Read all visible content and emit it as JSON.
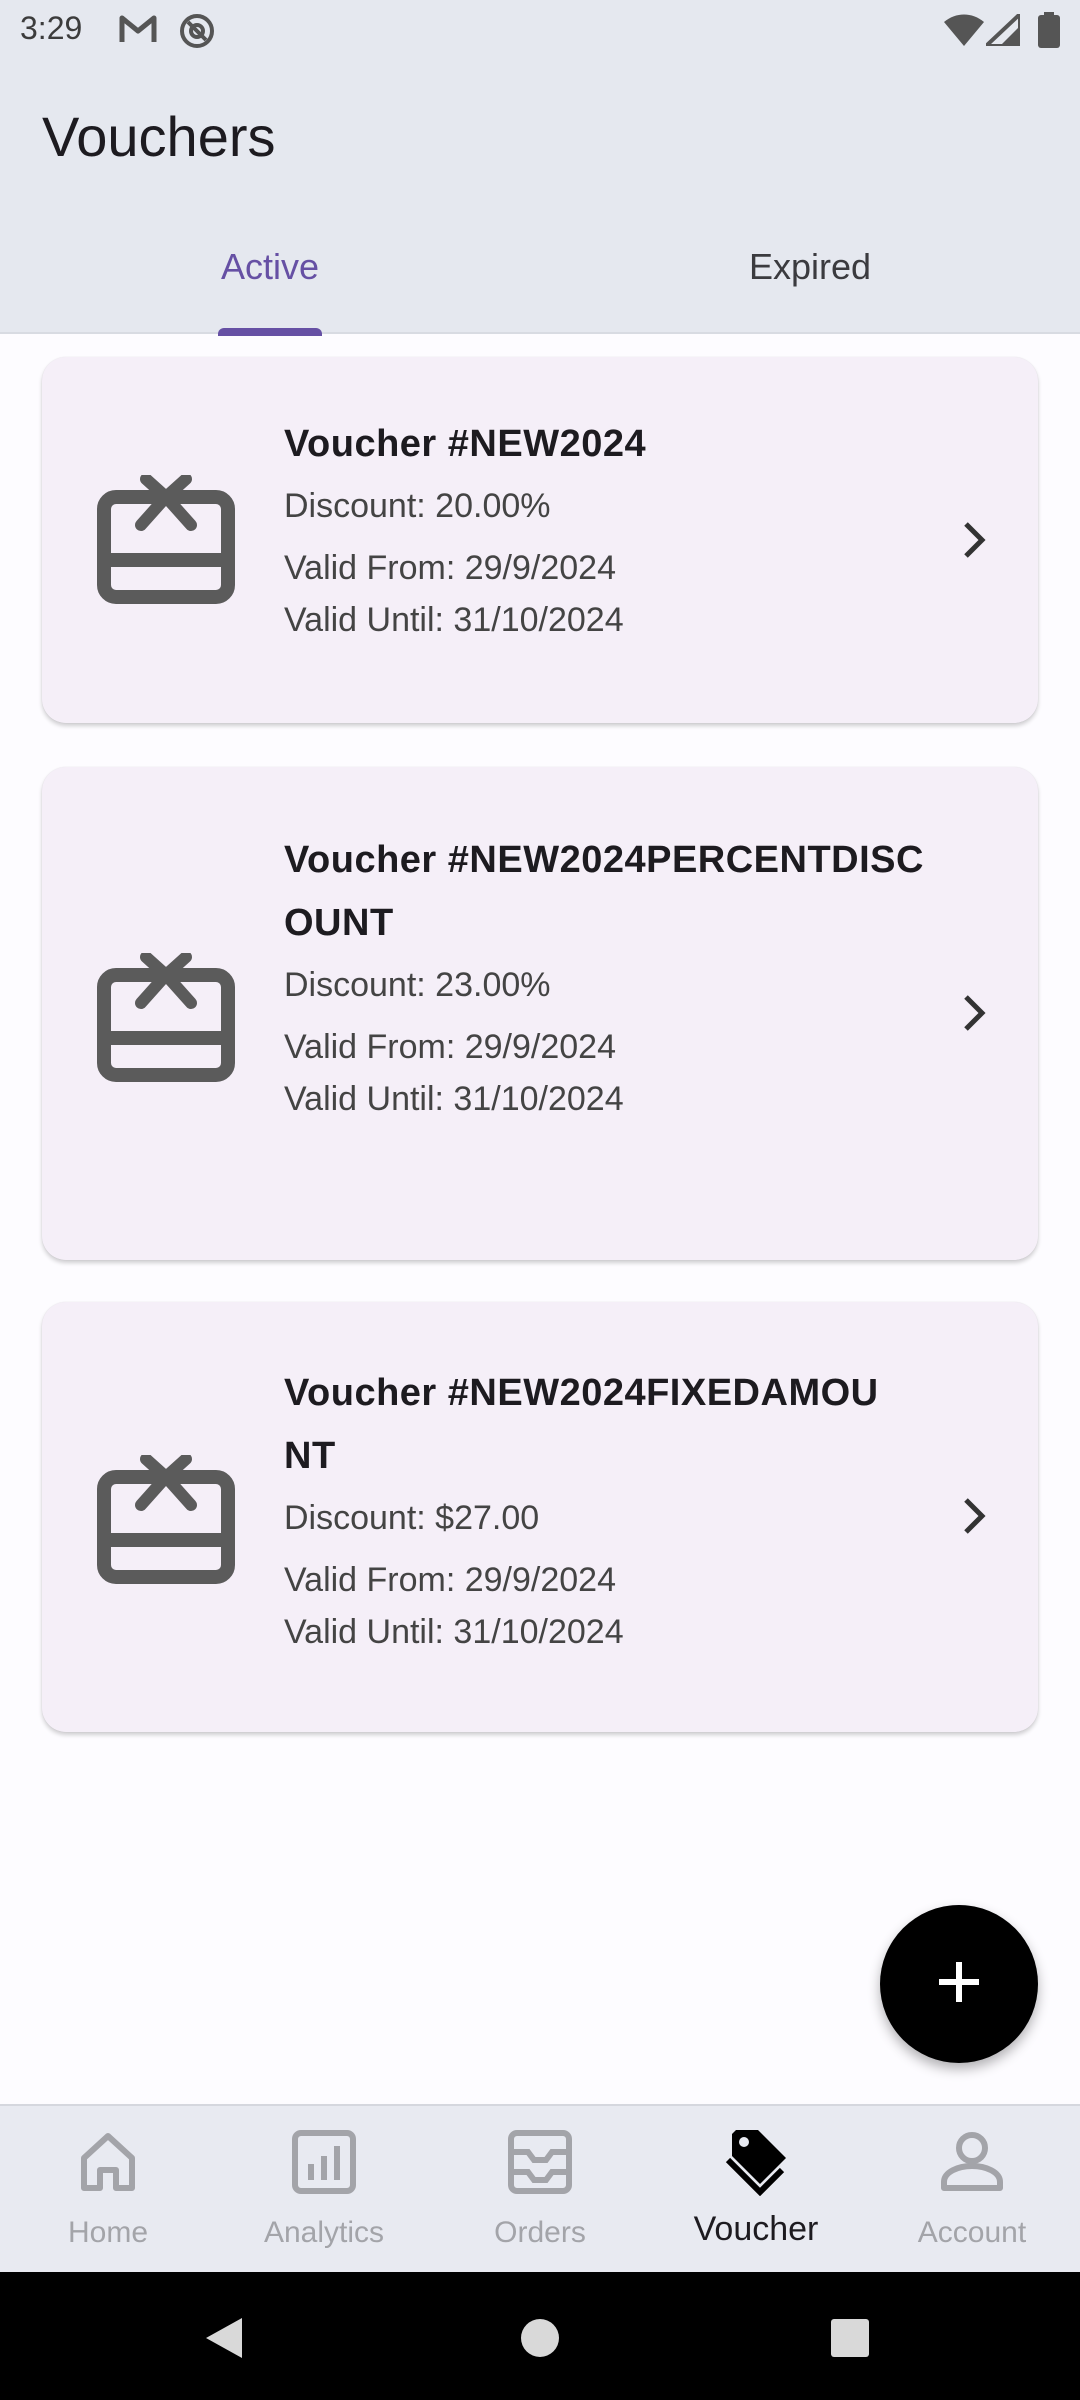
{
  "status_bar": {
    "time": "3:29"
  },
  "header": {
    "title": "Vouchers"
  },
  "tabs": [
    {
      "label": "Active",
      "selected": true
    },
    {
      "label": "Expired",
      "selected": false
    }
  ],
  "vouchers": [
    {
      "title": "Voucher #NEW2024",
      "discount": "Discount: 20.00%",
      "valid_from": "Valid From: 29/9/2024",
      "valid_until": "Valid Until: 31/10/2024"
    },
    {
      "title": "Voucher #NEW2024PERCENTDISCOUNT",
      "discount": "Discount: 23.00%",
      "valid_from": "Valid From: 29/9/2024",
      "valid_until": "Valid Until: 31/10/2024"
    },
    {
      "title": "Voucher #NEW2024FIXEDAMOUNT",
      "discount": "Discount: $27.00",
      "valid_from": "Valid From: 29/9/2024",
      "valid_until": "Valid Until: 31/10/2024"
    }
  ],
  "fab": {
    "icon": "plus-icon"
  },
  "bottom_nav": [
    {
      "label": "Home",
      "icon": "home-icon",
      "active": false
    },
    {
      "label": "Analytics",
      "icon": "analytics-icon",
      "active": false
    },
    {
      "label": "Orders",
      "icon": "orders-icon",
      "active": false
    },
    {
      "label": "Voucher",
      "icon": "voucher-tag-icon",
      "active": true
    },
    {
      "label": "Account",
      "icon": "account-icon",
      "active": false
    }
  ],
  "colors": {
    "accent": "#6650a4",
    "card_bg": "#f5eff8",
    "header_bg": "#e5e8ef",
    "fab_bg": "#000000"
  }
}
